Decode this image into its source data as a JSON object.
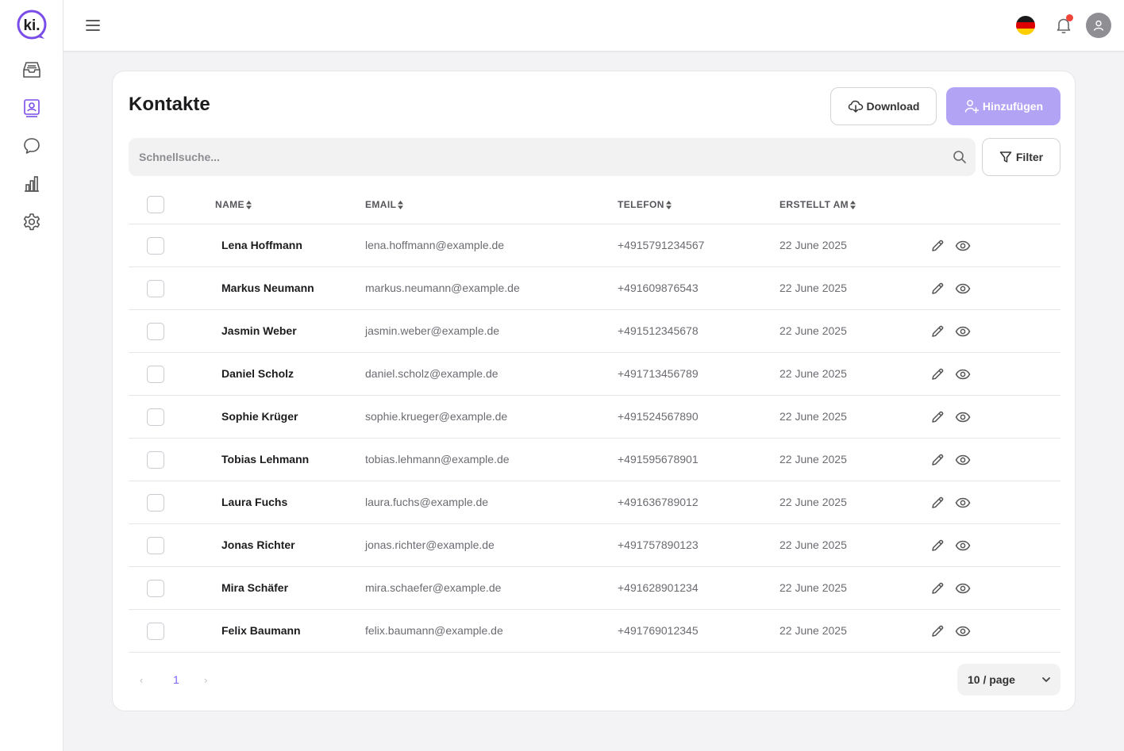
{
  "app": {
    "logo_text": "ki.",
    "brand_color": "#7b4de8",
    "accent_color": "#b3a3f5"
  },
  "sidebar": {
    "items": [
      {
        "icon": "inbox-icon"
      },
      {
        "icon": "contacts-icon",
        "active": true
      },
      {
        "icon": "chat-icon"
      },
      {
        "icon": "bar-chart-icon"
      },
      {
        "icon": "gear-icon"
      }
    ]
  },
  "header": {
    "language_flag": "de-flag-icon",
    "notification_badge": true
  },
  "page": {
    "title": "Kontakte",
    "download_label": "Download",
    "add_label": "Hinzufügen",
    "search_placeholder": "Schnellsuche...",
    "filter_label": "Filter"
  },
  "table": {
    "columns": [
      "NAME",
      "EMAIL",
      "TELEFON",
      "ERSTELLT AM"
    ],
    "rows": [
      {
        "name": "Lena Hoffmann",
        "email": "lena.hoffmann@example.de",
        "phone": "+4915791234567",
        "created": "22 June 2025"
      },
      {
        "name": "Markus Neumann",
        "email": "markus.neumann@example.de",
        "phone": "+491609876543",
        "created": "22 June 2025"
      },
      {
        "name": "Jasmin Weber",
        "email": "jasmin.weber@example.de",
        "phone": "+491512345678",
        "created": "22 June 2025"
      },
      {
        "name": "Daniel Scholz",
        "email": "daniel.scholz@example.de",
        "phone": "+491713456789",
        "created": "22 June 2025"
      },
      {
        "name": "Sophie Krüger",
        "email": "sophie.krueger@example.de",
        "phone": "+491524567890",
        "created": "22 June 2025"
      },
      {
        "name": "Tobias Lehmann",
        "email": "tobias.lehmann@example.de",
        "phone": "+491595678901",
        "created": "22 June 2025"
      },
      {
        "name": "Laura Fuchs",
        "email": "laura.fuchs@example.de",
        "phone": "+491636789012",
        "created": "22 June 2025"
      },
      {
        "name": "Jonas Richter",
        "email": "jonas.richter@example.de",
        "phone": "+491757890123",
        "created": "22 June 2025"
      },
      {
        "name": "Mira Schäfer",
        "email": "mira.schaefer@example.de",
        "phone": "+491628901234",
        "created": "22 June 2025"
      },
      {
        "name": "Felix Baumann",
        "email": "felix.baumann@example.de",
        "phone": "+491769012345",
        "created": "22 June 2025"
      }
    ]
  },
  "pagination": {
    "prev": "‹",
    "current_page": "1",
    "next": "›",
    "page_size_label": "10 / page"
  }
}
